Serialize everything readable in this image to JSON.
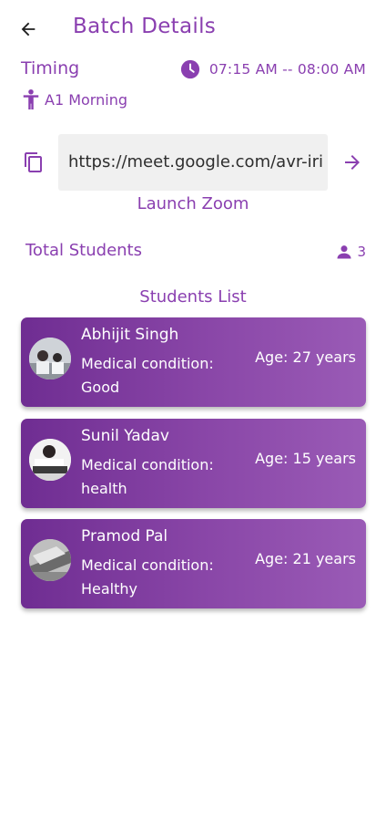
{
  "header": {
    "title": "Batch Details",
    "back_icon": "arrow-left-icon"
  },
  "timing": {
    "label": "Timing",
    "time_range": "07:15 AM -- 08:00 AM",
    "batch_name": "A1 Morning"
  },
  "meeting": {
    "link": "https://meet.google.com/avr-irie",
    "launch_label": "Launch Zoom"
  },
  "students_summary": {
    "label": "Total Students",
    "count": "3"
  },
  "students_list": {
    "title": "Students List",
    "condition_label": "Medical condition:",
    "items": [
      {
        "name": "Abhijit Singh",
        "condition": "Good",
        "age": "Age: 27 years"
      },
      {
        "name": "Sunil Yadav",
        "condition": "health",
        "age": "Age: 15 years"
      },
      {
        "name": "Pramod Pal",
        "condition": "Healthy",
        "age": "Age: 21 years"
      }
    ]
  },
  "colors": {
    "accent": "#8a3fb0",
    "card_start": "#6f2d92",
    "card_end": "#9a5bb6",
    "link_box": "#f0f0f0"
  }
}
